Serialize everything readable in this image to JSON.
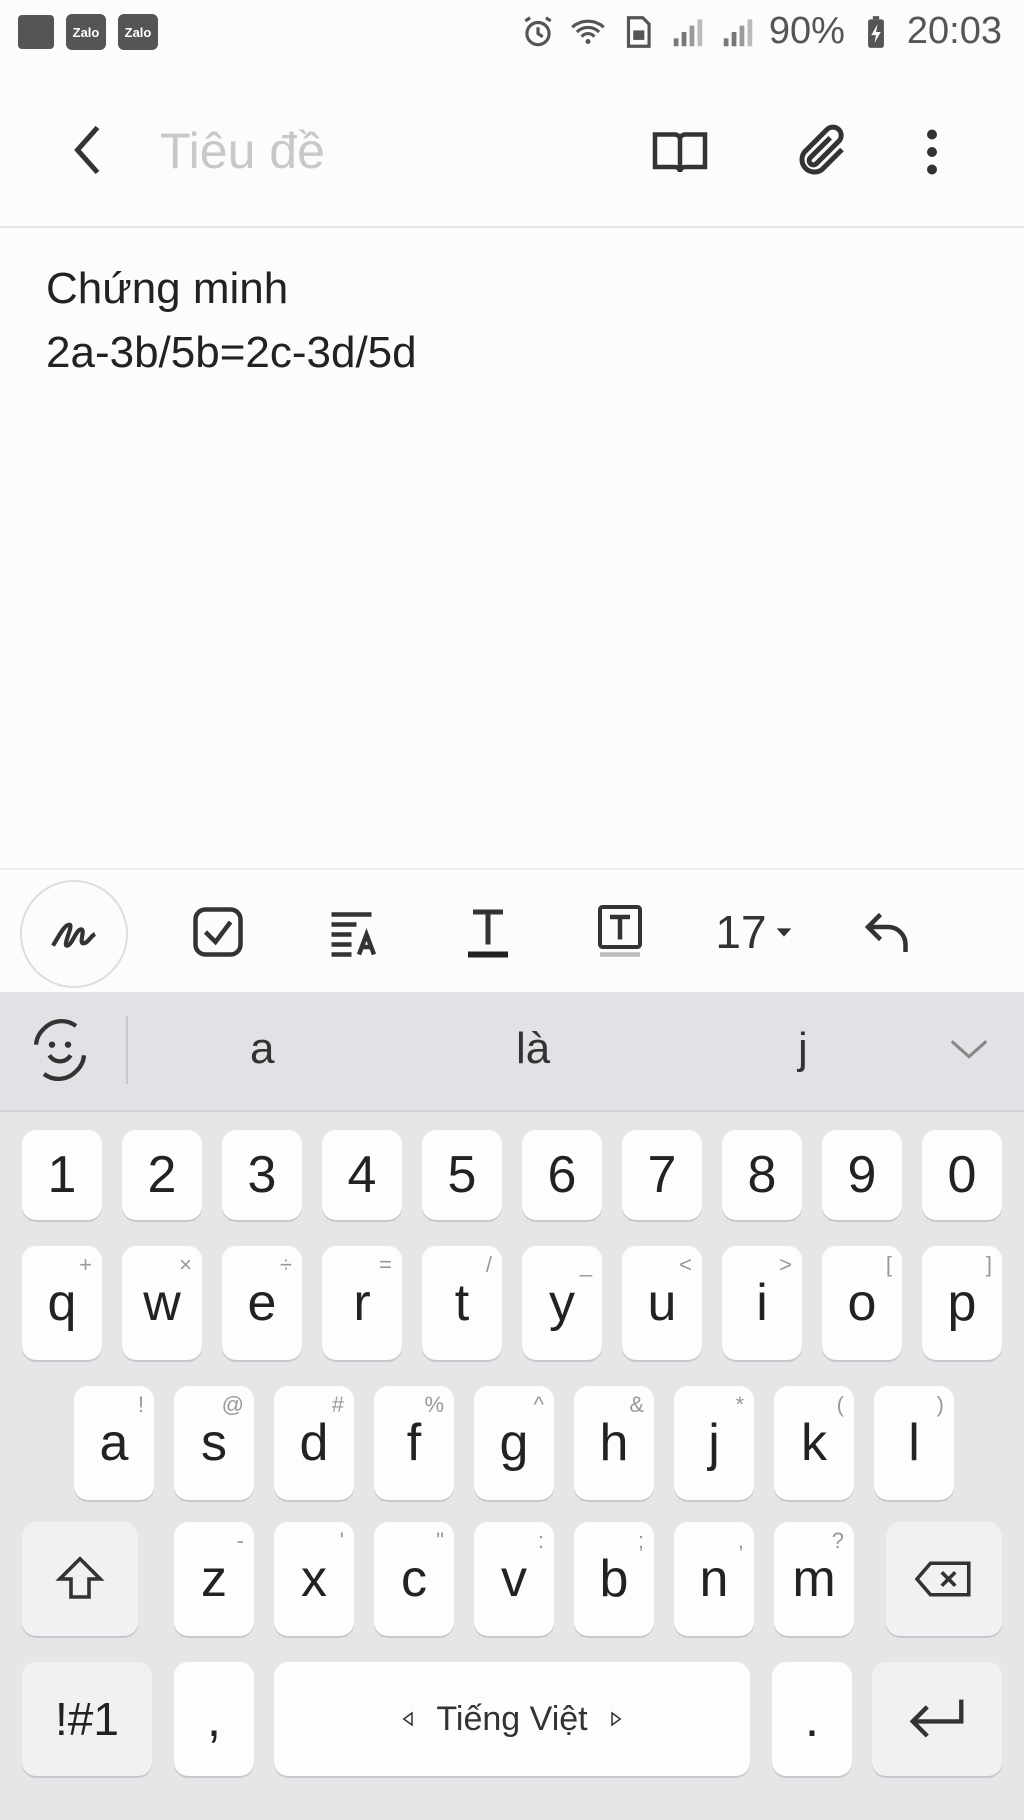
{
  "status_bar": {
    "app_icons": [
      "Zalo",
      "Zalo"
    ],
    "battery": "90%",
    "time": "20:03"
  },
  "app_bar": {
    "title_placeholder": "Tiêu đề"
  },
  "note": {
    "lines": [
      "Chứng minh",
      "2a-3b/5b=2c-3d/5d"
    ]
  },
  "toolbar": {
    "font_size": "17"
  },
  "suggestions": [
    "a",
    "là",
    "j"
  ],
  "keyboard": {
    "number_row": [
      "1",
      "2",
      "3",
      "4",
      "5",
      "6",
      "7",
      "8",
      "9",
      "0"
    ],
    "row1": [
      {
        "key": "q",
        "sub": "+"
      },
      {
        "key": "w",
        "sub": "×"
      },
      {
        "key": "e",
        "sub": "÷"
      },
      {
        "key": "r",
        "sub": "="
      },
      {
        "key": "t",
        "sub": "/"
      },
      {
        "key": "y",
        "sub": "_"
      },
      {
        "key": "u",
        "sub": "<"
      },
      {
        "key": "i",
        "sub": ">"
      },
      {
        "key": "o",
        "sub": "["
      },
      {
        "key": "p",
        "sub": "]"
      }
    ],
    "row2": [
      {
        "key": "a",
        "sub": "!"
      },
      {
        "key": "s",
        "sub": "@"
      },
      {
        "key": "d",
        "sub": "#"
      },
      {
        "key": "f",
        "sub": "%"
      },
      {
        "key": "g",
        "sub": "^"
      },
      {
        "key": "h",
        "sub": "&"
      },
      {
        "key": "j",
        "sub": "*"
      },
      {
        "key": "k",
        "sub": "("
      },
      {
        "key": "l",
        "sub": ")"
      }
    ],
    "row3": [
      {
        "key": "z",
        "sub": "-"
      },
      {
        "key": "x",
        "sub": "'"
      },
      {
        "key": "c",
        "sub": "\""
      },
      {
        "key": "v",
        "sub": ":"
      },
      {
        "key": "b",
        "sub": ";"
      },
      {
        "key": "n",
        "sub": ","
      },
      {
        "key": "m",
        "sub": "?"
      }
    ],
    "symbols_key": "!#1",
    "comma_key": ",",
    "space_label": "Tiếng Việt",
    "period_key": "."
  }
}
